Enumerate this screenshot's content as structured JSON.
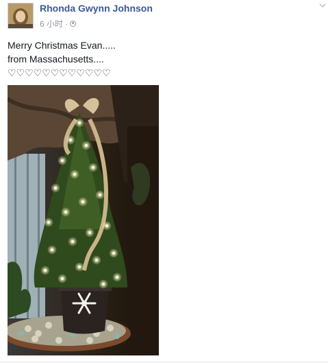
{
  "post": {
    "author": "Rhonda Gwynn Johnson",
    "timestamp": "6 小时",
    "separator": "·",
    "privacy_icon": "globe-icon",
    "menu_icon": "chevron-down-icon",
    "message_lines": [
      "Merry Christmas Evan.....",
      "from Massachusetts....",
      "♡♡♡♡♡♡♡♡♡♡♡♡"
    ],
    "photo_icon": "christmas-tree-photo"
  },
  "colors": {
    "author_link": "#3b5998",
    "meta_text": "#9197a3",
    "body_text": "#141823"
  }
}
